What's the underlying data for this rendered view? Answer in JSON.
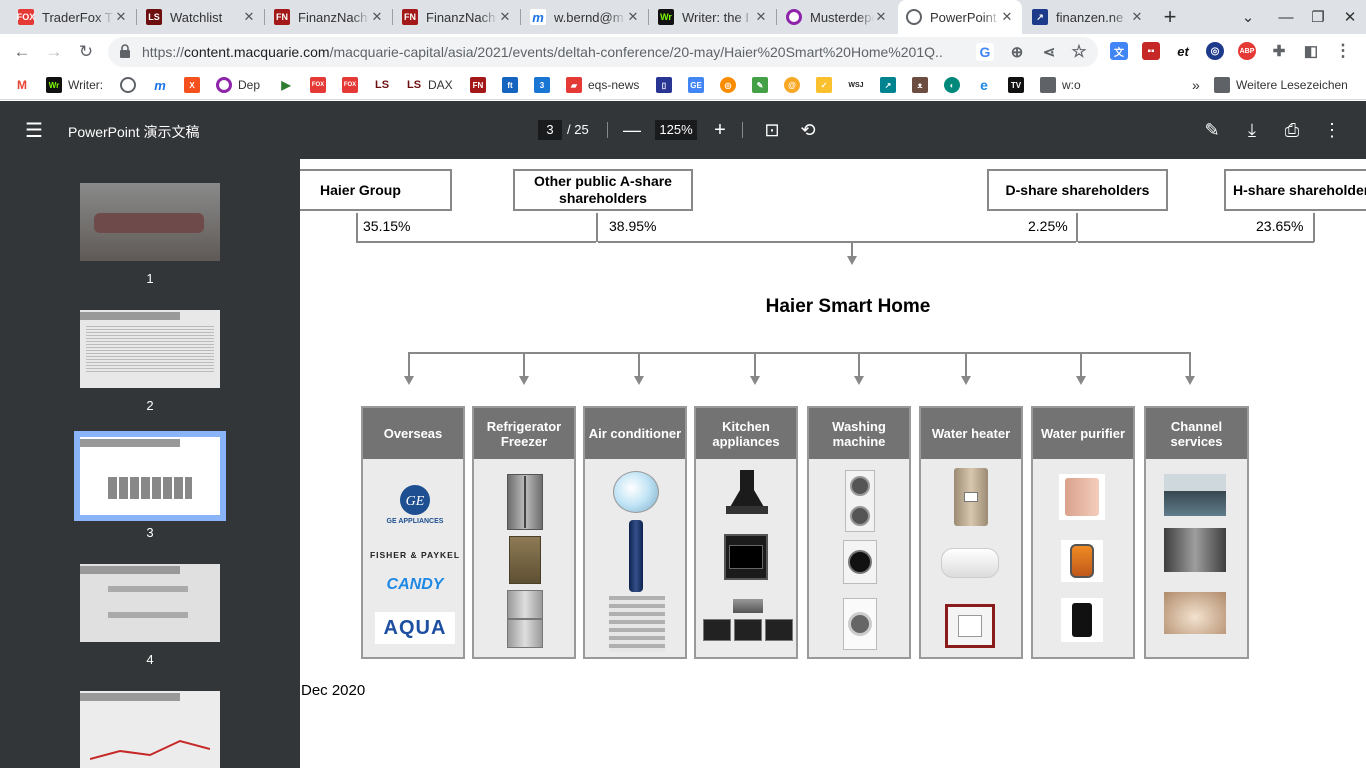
{
  "tabs": [
    {
      "title": "TraderFox T",
      "icon": "FOX",
      "color": "#e53935"
    },
    {
      "title": "Watchlist",
      "icon": "LS",
      "color": "#6d0f0f"
    },
    {
      "title": "FinanzNach",
      "icon": "FN",
      "color": "#a31919"
    },
    {
      "title": "FinanzNach",
      "icon": "FN",
      "color": "#a31919"
    },
    {
      "title": "w.bernd@m",
      "icon": "m",
      "color": "#1a73e8"
    },
    {
      "title": "Writer: the I",
      "icon": "Wr",
      "color": "#111111"
    },
    {
      "title": "Musterdepo",
      "icon": "O",
      "color": "#8e24aa"
    },
    {
      "title": "PowerPoint",
      "icon": "globe",
      "color": "#5f6368"
    },
    {
      "title": "finanzen.ne",
      "icon": "fn",
      "color": "#1e3a8a"
    }
  ],
  "url": "https://content.macquarie.com/macquarie-capital/asia/2021/events/deltah-conference/20-may/Haier%20Smart%20Home%201Q...",
  "url_host": "content.macquarie.com",
  "bookmarks": [
    {
      "label": "",
      "icon": "M",
      "color": "#ea4335"
    },
    {
      "label": "Writer:",
      "icon": "Wr",
      "color": "#111111"
    },
    {
      "label": "",
      "icon": "globe",
      "color": "#5f6368"
    },
    {
      "label": "",
      "icon": "m",
      "color": "#1a73e8"
    },
    {
      "label": "",
      "icon": "X",
      "color": "#f4511e"
    },
    {
      "label": "Dep",
      "icon": "O",
      "color": "#8e24aa"
    },
    {
      "label": "",
      "icon": "▶",
      "color": "#2e7d32"
    },
    {
      "label": "",
      "icon": "FOX",
      "color": "#e53935"
    },
    {
      "label": "",
      "icon": "FOX",
      "color": "#e53935"
    },
    {
      "label": "",
      "icon": "LS",
      "color": "#6d0f0f"
    },
    {
      "label": "DAX",
      "icon": "LS",
      "color": "#6d0f0f"
    },
    {
      "label": "",
      "icon": "FN",
      "color": "#a31919"
    },
    {
      "label": "",
      "icon": "ft",
      "color": "#1565c0"
    },
    {
      "label": "",
      "icon": "3",
      "color": "#1976d2"
    },
    {
      "label": "eqs-news",
      "icon": "eq",
      "color": "#e53935"
    },
    {
      "label": "",
      "icon": "▯",
      "color": "#283593"
    },
    {
      "label": "",
      "icon": "GE",
      "color": "#4285f4"
    },
    {
      "label": "",
      "icon": "◎",
      "color": "#fb8c00"
    },
    {
      "label": "",
      "icon": "✎",
      "color": "#43a047"
    },
    {
      "label": "",
      "icon": "@",
      "color": "#f9a825"
    },
    {
      "label": "",
      "icon": "✓",
      "color": "#fbc02d"
    },
    {
      "label": "",
      "icon": "WSJ",
      "color": "#222222"
    },
    {
      "label": "",
      "icon": "↗",
      "color": "#00838f"
    },
    {
      "label": "",
      "icon": "ᴥ",
      "color": "#6d4c41"
    },
    {
      "label": "",
      "icon": "◐",
      "color": "#00897b"
    },
    {
      "label": "",
      "icon": "e",
      "color": "#1e88e5"
    },
    {
      "label": "",
      "icon": "TV",
      "color": "#111111"
    },
    {
      "label": "w:o",
      "icon": "folder",
      "color": "#5f6368"
    }
  ],
  "bookmarks_more": "»",
  "other_bookmarks": "Weitere Lesezeichen",
  "pdf": {
    "title": "PowerPoint 演示文稿",
    "page": "3",
    "total": "/ 25",
    "zoom": "125%"
  },
  "thumbnails": [
    {
      "num": "1"
    },
    {
      "num": "2"
    },
    {
      "num": "3"
    },
    {
      "num": "4"
    },
    {
      "num": ""
    }
  ],
  "shareholders": [
    {
      "name": "Haier Group",
      "pct": "35.15%"
    },
    {
      "name": "Other public A-share shareholders",
      "pct": "38.95%"
    },
    {
      "name": "D-share shareholders",
      "pct": "2.25%"
    },
    {
      "name": "H-share shareholders",
      "pct": "23.65%"
    }
  ],
  "company": "Haier Smart Home",
  "categories": [
    {
      "name": "Overseas"
    },
    {
      "name": "Refrigerator Freezer"
    },
    {
      "name": "Air conditioner"
    },
    {
      "name": "Kitchen appliances"
    },
    {
      "name": "Washing machine"
    },
    {
      "name": "Water heater"
    },
    {
      "name": "Water purifier"
    },
    {
      "name": "Channel services"
    }
  ],
  "brands": {
    "ge": "GE APPLIANCES",
    "fp": "FISHER & PAYKEL",
    "candy": "CANDY",
    "aqua": "AQUA"
  },
  "date": "Dec 2020"
}
